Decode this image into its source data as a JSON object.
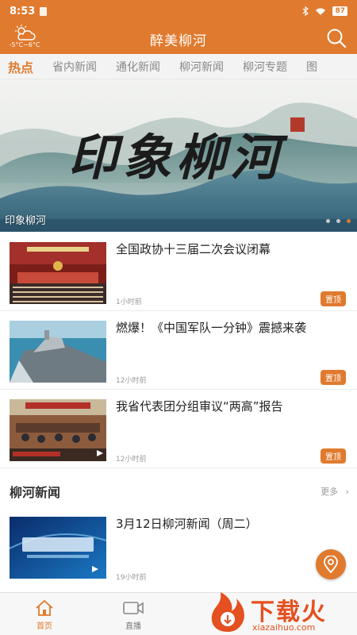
{
  "status_bar": {
    "time": "8:53",
    "battery": "87"
  },
  "header": {
    "title": "醉美柳河",
    "weather_temp": "-5°C~6°C"
  },
  "tabs": [
    {
      "label": "热点",
      "active": true
    },
    {
      "label": "省内新闻"
    },
    {
      "label": "通化新闻"
    },
    {
      "label": "柳河新闻"
    },
    {
      "label": "柳河专题"
    },
    {
      "label": "图"
    }
  ],
  "banner": {
    "caption": "印象柳河",
    "calligraphy": "印象柳河",
    "slides": 3,
    "active_slide": 3
  },
  "news": [
    {
      "title": "全国政协十三届二次会议闭幕",
      "time": "1小时前",
      "badge": "置顶"
    },
    {
      "title": "燃爆！《中国军队一分钟》震撼来袭",
      "time": "12小时前",
      "badge": "置顶"
    },
    {
      "title": "我省代表团分组审议“两高”报告",
      "time": "12小时前",
      "badge": "置顶"
    }
  ],
  "section": {
    "title": "柳河新闻",
    "more": "更多",
    "items": [
      {
        "title": "3月12日柳河新闻（周二）",
        "time": "19小时前"
      }
    ]
  },
  "bottom_nav": {
    "home": "首页",
    "live": "直播"
  },
  "watermark": {
    "text": "下载火",
    "sub": "xiazaihuo.com"
  },
  "colors": {
    "accent": "#e07a2e",
    "tab_bg": "#f3f3f3"
  }
}
